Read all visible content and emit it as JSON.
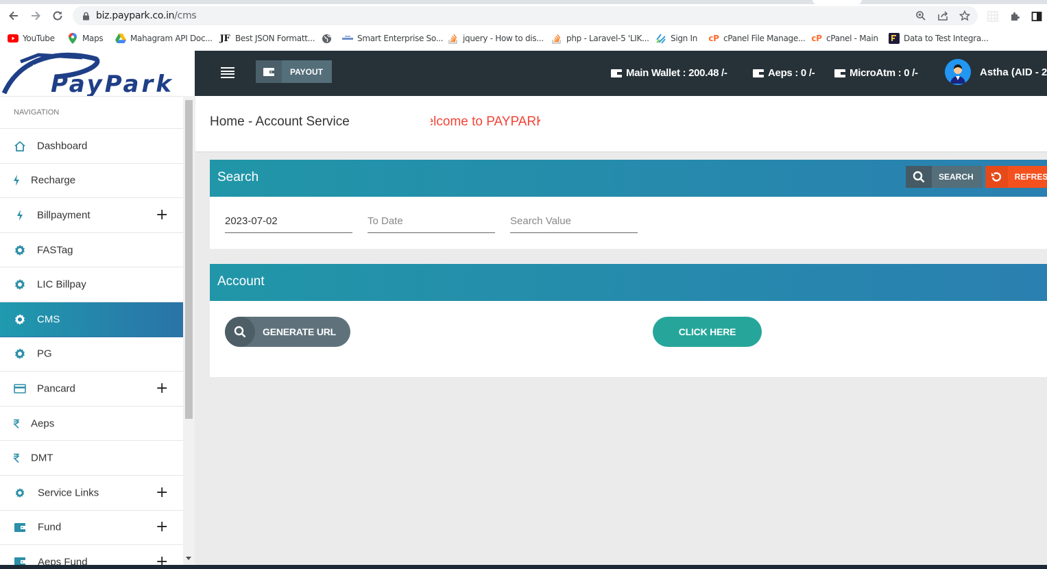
{
  "browser": {
    "url_host": "biz.paypark.co.in",
    "url_path": "/cms",
    "bookmarks": [
      {
        "label": "YouTube",
        "icon": "youtube-icon"
      },
      {
        "label": "Maps",
        "icon": "maps-pin-icon"
      },
      {
        "label": "Mahagram API Doc...",
        "icon": "google-drive-icon"
      },
      {
        "label": "Best JSON Formatt...",
        "icon": "jf-icon"
      },
      {
        "label": "",
        "icon": "globe-icon"
      },
      {
        "label": "Smart Enterprise So...",
        "icon": "smart-enterprise-icon"
      },
      {
        "label": "jquery - How to dis...",
        "icon": "stackoverflow-icon"
      },
      {
        "label": "php - Laravel-5 'LIK...",
        "icon": "stackoverflow-icon"
      },
      {
        "label": "Sign In",
        "icon": "sign-in-icon"
      },
      {
        "label": "cPanel File Manage...",
        "icon": "cpanel-icon"
      },
      {
        "label": "cPanel - Main",
        "icon": "cpanel-icon"
      },
      {
        "label": "Data to Test Integra...",
        "icon": "data-test-icon"
      }
    ]
  },
  "header": {
    "logo_text": "PayPark",
    "payout_label": "PAYOUT",
    "wallets": [
      {
        "label": "Main Wallet : 200.48 /-"
      },
      {
        "label": "Aeps : 0 /-"
      },
      {
        "label": "MicroAtm : 0 /-"
      }
    ],
    "user_name": "Astha (AID - 2"
  },
  "sidebar": {
    "heading": "NAVIGATION",
    "items": [
      {
        "label": "Dashboard",
        "icon": "home-icon",
        "expandable": false,
        "active": false
      },
      {
        "label": "Recharge",
        "icon": "bolt-icon",
        "expandable": false,
        "active": false
      },
      {
        "label": "Billpayment",
        "icon": "bolt-icon",
        "expandable": true,
        "active": false
      },
      {
        "label": "FASTag",
        "icon": "gear-icon",
        "expandable": false,
        "active": false
      },
      {
        "label": "LIC Billpay",
        "icon": "gear-icon",
        "expandable": false,
        "active": false
      },
      {
        "label": "CMS",
        "icon": "gear-icon",
        "expandable": false,
        "active": true
      },
      {
        "label": "PG",
        "icon": "gear-icon",
        "expandable": false,
        "active": false
      },
      {
        "label": "Pancard",
        "icon": "card-icon",
        "expandable": true,
        "active": false
      },
      {
        "label": "Aeps",
        "icon": "rupee-icon",
        "expandable": false,
        "active": false
      },
      {
        "label": "DMT",
        "icon": "rupee-icon",
        "expandable": false,
        "active": false
      },
      {
        "label": "Service Links",
        "icon": "gear-icon",
        "expandable": true,
        "active": false
      },
      {
        "label": "Fund",
        "icon": "wallet-icon",
        "expandable": true,
        "active": false
      },
      {
        "label": "Aeps Fund",
        "icon": "wallet-icon",
        "expandable": true,
        "active": false
      }
    ],
    "expand_symbol": "+"
  },
  "page": {
    "breadcrumb": "Home - Account Service",
    "marquee": "Welcome to PAYPARK"
  },
  "search_card": {
    "title": "Search",
    "search_label": "SEARCH",
    "refresh_label": "REFRESH",
    "from_date_value": "2023-07-02",
    "to_date_placeholder": "To Date",
    "search_value_placeholder": "Search Value"
  },
  "account_card": {
    "title": "Account",
    "generate_label": "GENERATE URL",
    "click_label": "CLICK HERE"
  },
  "colors": {
    "topbar": "#263238",
    "accent_teal": "#2196a8",
    "accent_blue": "#2a73a7",
    "refresh": "#f4511e",
    "click_here": "#26a69a",
    "marquee": "#f44336"
  }
}
